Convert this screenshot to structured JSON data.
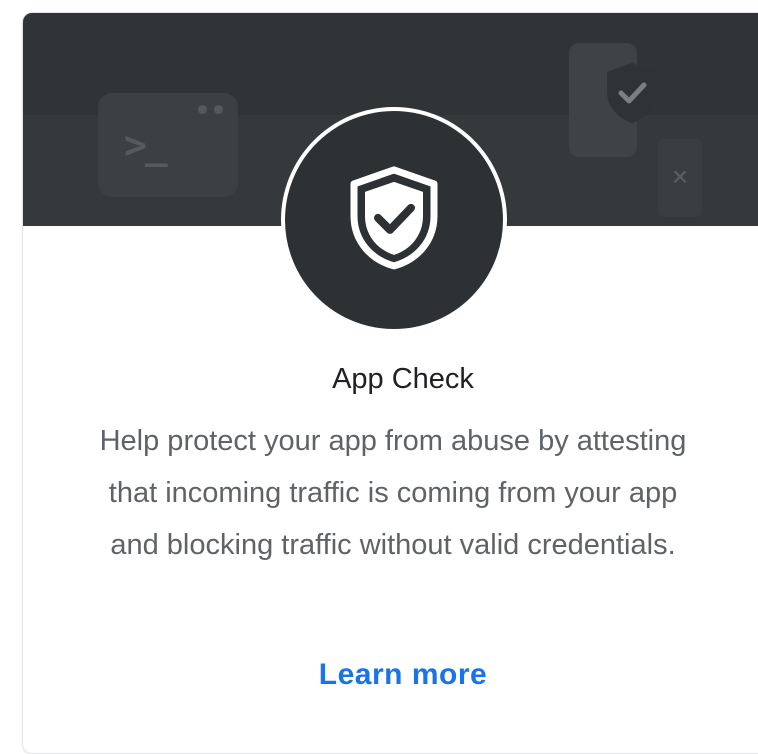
{
  "card": {
    "title": "App Check",
    "description": "Help protect your app from abuse by attesting that incoming traffic is coming from your app and blocking traffic without valid credentials.",
    "link_label": "Learn more"
  },
  "banner": {
    "terminal_prompt": ">_",
    "close_glyph": "×"
  },
  "icons": {
    "hero": "shield-check-icon",
    "terminal": "terminal-icon",
    "device": "mobile-device-icon",
    "badge": "shield-check-icon",
    "close": "close-icon"
  },
  "colors": {
    "banner": "#303437",
    "hero_circle": "#2e3134",
    "link": "#1a73e8",
    "title": "#202124",
    "body_text": "#5f6368"
  }
}
